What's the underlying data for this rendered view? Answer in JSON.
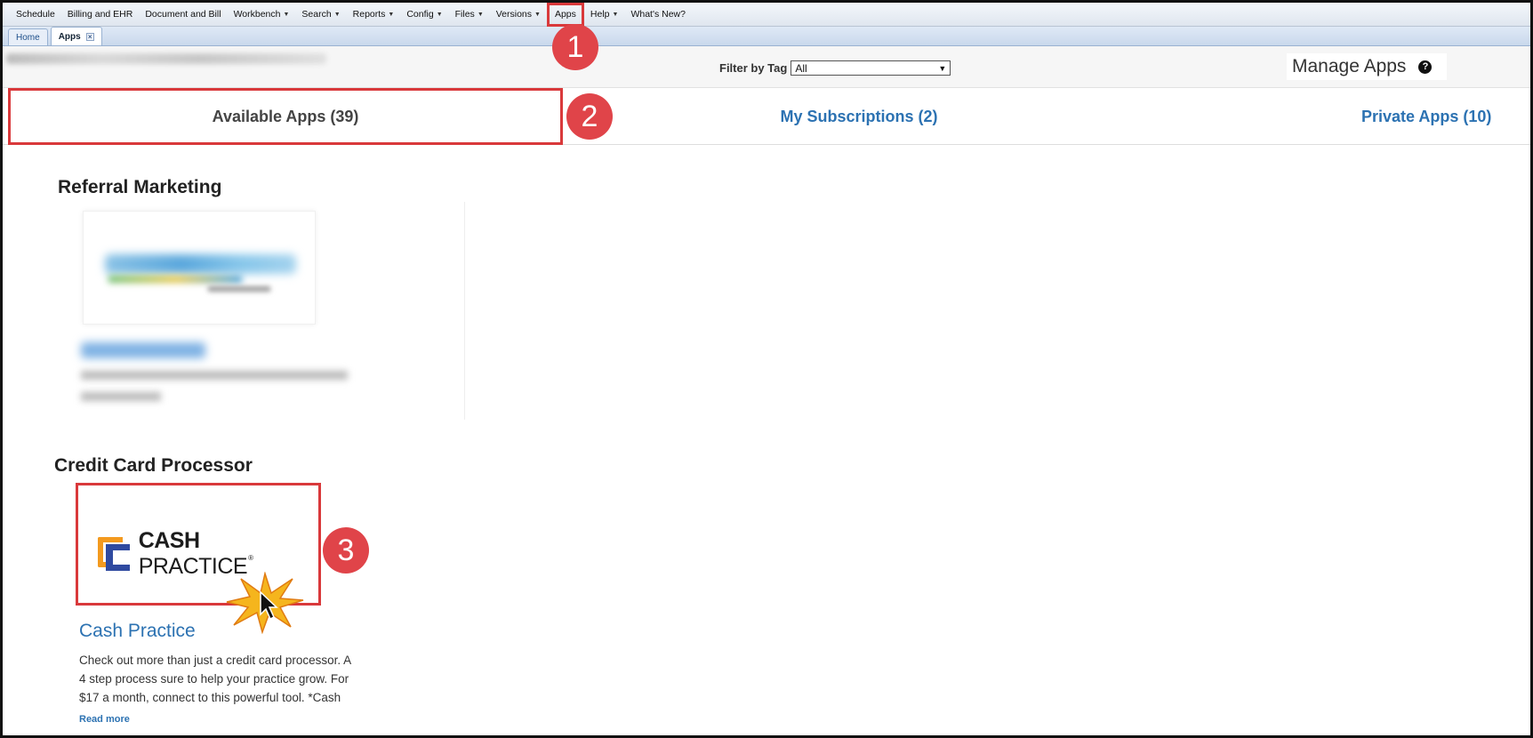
{
  "menubar": {
    "items": [
      {
        "label": "Schedule",
        "dropdown": false
      },
      {
        "label": "Billing and EHR",
        "dropdown": false
      },
      {
        "label": "Document and Bill",
        "dropdown": false
      },
      {
        "label": "Workbench",
        "dropdown": true
      },
      {
        "label": "Search",
        "dropdown": true
      },
      {
        "label": "Reports",
        "dropdown": true
      },
      {
        "label": "Config",
        "dropdown": true
      },
      {
        "label": "Files",
        "dropdown": true
      },
      {
        "label": "Versions",
        "dropdown": true
      },
      {
        "label": "Apps",
        "dropdown": false
      },
      {
        "label": "Help",
        "dropdown": true
      },
      {
        "label": "What's New?",
        "dropdown": false
      }
    ]
  },
  "tabs": {
    "home": "Home",
    "apps": "Apps",
    "close_glyph": "×"
  },
  "header": {
    "filter_label": "Filter by Tag",
    "filter_value": "All",
    "manage_title": "Manage Apps",
    "help_glyph": "?"
  },
  "app_tabs": {
    "available": "Available Apps (39)",
    "subscriptions": "My Subscriptions (2)",
    "private": "Private Apps (10)"
  },
  "badges": {
    "one": "1",
    "two": "2",
    "three": "3"
  },
  "sections": {
    "referral": "Referral Marketing",
    "credit": "Credit Card Processor"
  },
  "cash_practice": {
    "logo_cash": "CASH",
    "logo_practice": " PRACTICE",
    "logo_tm": "®",
    "title": "Cash Practice",
    "description": "Check out more than just a credit card processor. A 4 step process sure to help your practice grow. For $17 a month, connect to this powerful tool. *Cash",
    "read_more": "Read more"
  },
  "colors": {
    "accent_red": "#d9393b",
    "link_blue": "#2c72b2",
    "logo_orange": "#f39a1f",
    "logo_navy": "#2f4aa0"
  }
}
